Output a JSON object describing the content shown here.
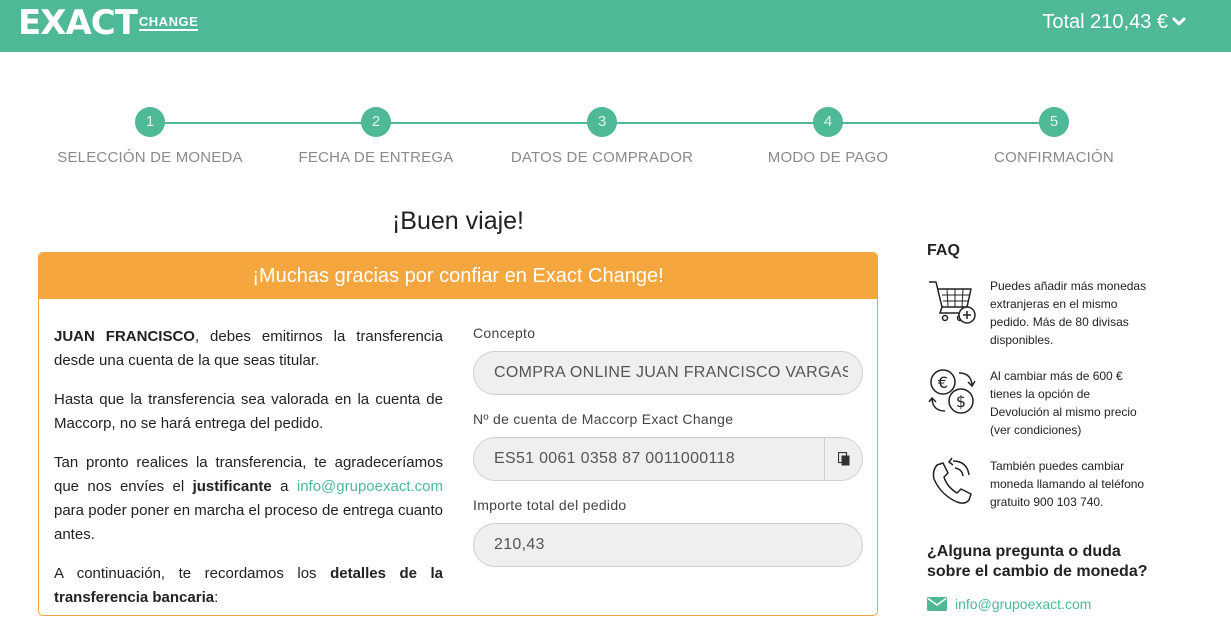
{
  "header": {
    "brand": "EXACT",
    "brand_sub": "CHANGE",
    "cart_total": "Total 210,43 €",
    "colors": {
      "primary": "#4fb896",
      "accent": "#f5a63f"
    }
  },
  "steps": [
    {
      "number": "1",
      "label": "SELECCIÓN DE MONEDA"
    },
    {
      "number": "2",
      "label": "FECHA DE ENTREGA"
    },
    {
      "number": "3",
      "label": "DATOS DE COMPRADOR"
    },
    {
      "number": "4",
      "label": "MODO DE PAGO"
    },
    {
      "number": "5",
      "label": "CONFIRMACIÓN"
    }
  ],
  "main": {
    "title": "¡Buen viaje!",
    "card_title": "¡Muchas gracias por confiar en Exact Change!",
    "paragraphs": {
      "p1_name": "JUAN FRANCISCO",
      "p1_text": ", debes emitirnos la transferencia desde una cuenta de la que seas titular.",
      "p2": "Hasta que la transferencia sea valorada en la cuenta de Maccorp, no se hará entrega del pedido.",
      "p3_a": "Tan pronto realices la transferencia, te agradeceríamos que nos envíes el ",
      "p3_bold": "justificante",
      "p3_b": " a ",
      "p3_link": "info@grupoexact.com",
      "p3_c": " para poder poner en marcha el proceso de entrega cuanto antes.",
      "p4_a": "A continuación, te recordamos los ",
      "p4_bold": "detalles de la transferencia bancaria",
      "p4_c": ":"
    },
    "fields": {
      "concept_label": "Concepto",
      "concept_value": "COMPRA ONLINE JUAN FRANCISCO VARGAS SE",
      "account_label": "Nº de cuenta de Maccorp Exact Change",
      "account_value": "ES51 0061 0358 87 0011000118",
      "amount_label": "Importe total del pedido",
      "amount_value": "210,43"
    }
  },
  "sidebar": {
    "faq_title": "FAQ",
    "items": [
      {
        "icon": "cart-add-icon",
        "text": "Puedes añadir más monedas extranjeras en el mismo pedido. Más de 80 divisas disponibles."
      },
      {
        "icon": "currency-exchange-icon",
        "text": "Al cambiar más de 600 € tienes la opción de Devolución al mismo precio (ver condiciones)"
      },
      {
        "icon": "phone-icon",
        "text": "También puedes cambiar moneda llamando al teléfono gratuito 900 103 740."
      }
    ],
    "question": "¿Alguna pregunta o duda sobre el cambio de moneda?",
    "contact_email": "info@grupoexact.com"
  }
}
